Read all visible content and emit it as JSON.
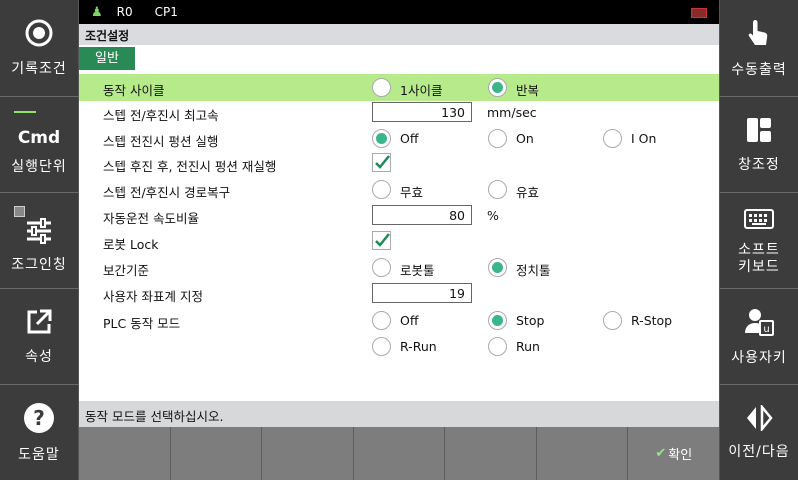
{
  "left_sidebar": [
    {
      "label": "기록조건",
      "icon": "record-circle-icon"
    },
    {
      "label": "실행단위",
      "icon": "cmd-icon",
      "icon_text": "Cmd"
    },
    {
      "label": "조그인칭",
      "icon": "sliders-icon"
    },
    {
      "label": "속성",
      "icon": "external-link-icon"
    },
    {
      "label": "도움말",
      "icon": "help-icon"
    }
  ],
  "right_sidebar": [
    {
      "label": "수동출력",
      "icon": "hand-pointer-icon"
    },
    {
      "label": "창조정",
      "icon": "window-layout-icon"
    },
    {
      "label": "소프트\n키보드",
      "icon": "keyboard-icon"
    },
    {
      "label": "사용자키",
      "icon": "user-key-icon"
    },
    {
      "label": "이전/다음",
      "icon": "prev-next-icon"
    }
  ],
  "topbar": {
    "r0": "R0",
    "cp1": "CP1"
  },
  "title": "조건설정",
  "tab": "일반",
  "rows": {
    "r1": {
      "label": "동작 사이클",
      "opt1": "1사이클",
      "opt2": "반복"
    },
    "r2": {
      "label": "스텝 전/후진시 최고속",
      "value": "130",
      "unit": "mm/sec"
    },
    "r3": {
      "label": "스텝 전진시 펑션 실행",
      "opt1": "Off",
      "opt2": "On",
      "opt3": "I On"
    },
    "r4": {
      "label": "스텝 후진 후, 전진시 펑션 재실행"
    },
    "r5": {
      "label": "스텝 전/후진시 경로복구",
      "opt1": "무효",
      "opt2": "유효"
    },
    "r6": {
      "label": "자동운전 속도비율",
      "value": "80",
      "unit": "%"
    },
    "r7": {
      "label": "로봇 Lock"
    },
    "r8": {
      "label": "보간기준",
      "opt1": "로봇툴",
      "opt2": "정치툴"
    },
    "r9": {
      "label": "사용자 좌표계 지정",
      "value": "19"
    },
    "r10": {
      "label": "PLC 동작 모드",
      "opt1": "Off",
      "opt2": "Stop",
      "opt3": "R-Stop",
      "opt4": "R-Run",
      "opt5": "Run"
    }
  },
  "status": "동작 모드를 선택하십시오.",
  "fkeys": [
    "",
    "",
    "",
    "",
    "",
    "",
    "확인"
  ]
}
